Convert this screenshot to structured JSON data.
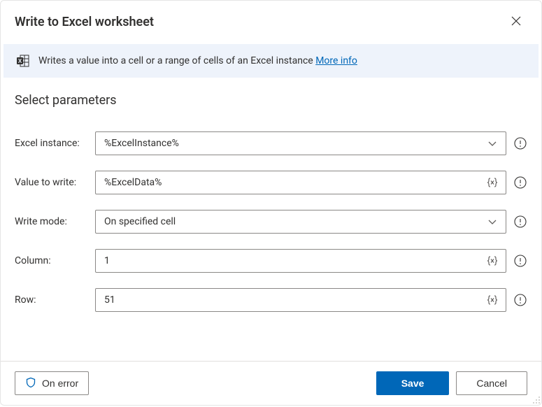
{
  "title": "Write to Excel worksheet",
  "banner": {
    "text": "Writes a value into a cell or a range of cells of an Excel instance",
    "link": "More info"
  },
  "section_heading": "Select parameters",
  "fields": {
    "excel_instance": {
      "label": "Excel instance:",
      "value": "%ExcelInstance%"
    },
    "value_to_write": {
      "label": "Value to write:",
      "value": "%ExcelData%"
    },
    "write_mode": {
      "label": "Write mode:",
      "value": "On specified cell"
    },
    "column": {
      "label": "Column:",
      "value": "1"
    },
    "row": {
      "label": "Row:",
      "value": "51"
    }
  },
  "footer": {
    "on_error": "On error",
    "save": "Save",
    "cancel": "Cancel"
  }
}
